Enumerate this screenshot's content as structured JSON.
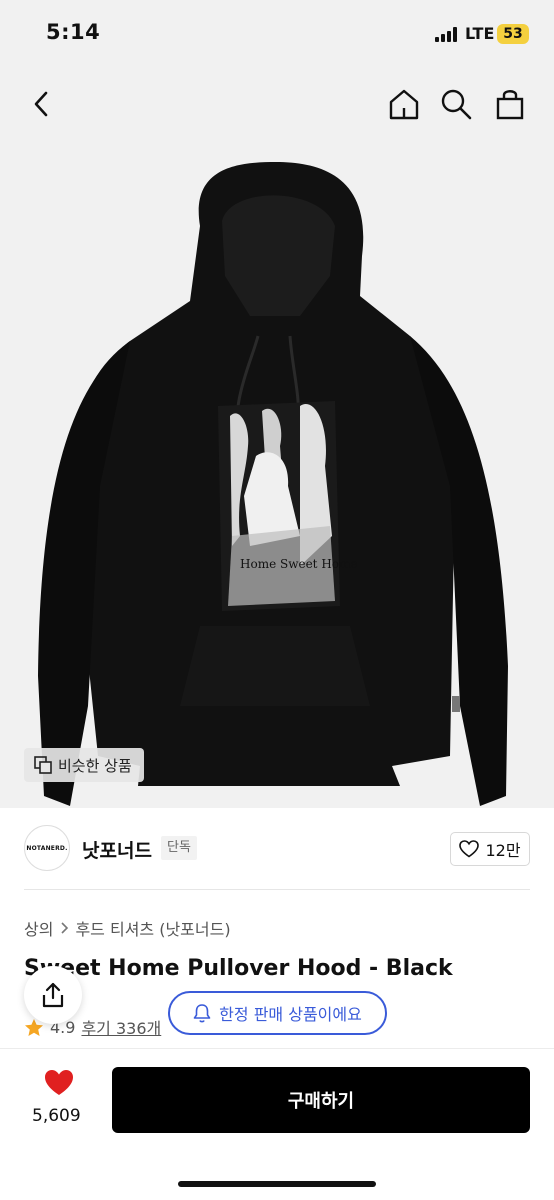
{
  "status": {
    "time": "5:14",
    "network": "LTE",
    "battery": "53"
  },
  "nav": {
    "back_icon": "chevron-left-icon",
    "home_icon": "home-icon",
    "search_icon": "search-icon",
    "cart_icon": "shopping-bag-icon"
  },
  "hero": {
    "print_text": "Home Sweet Home",
    "similar_label": "비슷한 상품"
  },
  "brand": {
    "logo_text": "NOTANERD.",
    "name": "낫포너드",
    "tag": "단독",
    "like_count": "12만"
  },
  "breadcrumb": [
    "상의",
    "후드 티셔츠 (낫포너드)"
  ],
  "product": {
    "title": "Sweet Home Pullover Hood - Black",
    "rating": "4.9",
    "review_label": "후기 336개"
  },
  "limited_label": "한정 판매 상품이에요",
  "bottom": {
    "likes": "5,609",
    "buy_label": "구매하기"
  },
  "colors": {
    "accent_blue": "#3a5bd9",
    "heart_red": "#e02020",
    "star": "#f5a623",
    "buy_button": "#000000"
  }
}
